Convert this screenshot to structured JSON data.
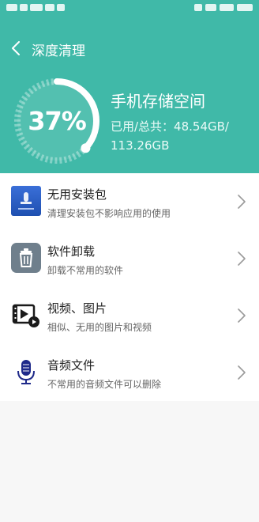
{
  "colors": {
    "accent": "#40b9a8",
    "text_primary": "#222222",
    "text_secondary": "#666666"
  },
  "header": {
    "title": "深度清理",
    "back_icon": "chevron-left-icon"
  },
  "storage": {
    "percent_text": "37%",
    "percent_value": 0.37,
    "title": "手机存储空间",
    "usage_line1": "已用/总共：48.54GB/",
    "usage_line2": "113.26GB"
  },
  "items": [
    {
      "title": "无用安装包",
      "subtitle": "清理安装包不影响应用的使用",
      "icon": "apk-package-icon"
    },
    {
      "title": "软件卸载",
      "subtitle": "卸载不常用的软件",
      "icon": "trash-can-icon"
    },
    {
      "title": "视频、图片",
      "subtitle": "相似、无用的图片和视频",
      "icon": "video-image-icon"
    },
    {
      "title": "音频文件",
      "subtitle": "不常用的音频文件可以删除",
      "icon": "microphone-icon"
    }
  ]
}
